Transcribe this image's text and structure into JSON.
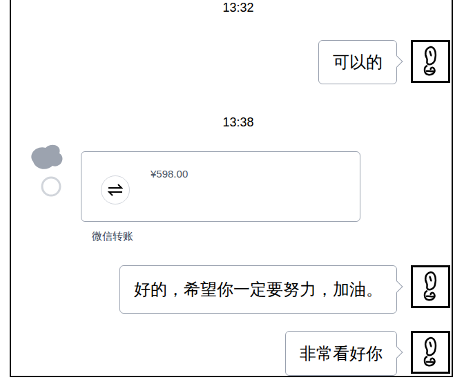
{
  "messages": [
    {
      "kind": "time",
      "text": "13:32"
    },
    {
      "kind": "sent",
      "text": "可以的"
    },
    {
      "kind": "time",
      "text": "13:38"
    },
    {
      "kind": "transfer",
      "amount": "¥598.00",
      "label": "微信转账"
    },
    {
      "kind": "sent",
      "text": "好的，希望你一定要努力，加油。"
    },
    {
      "kind": "sent",
      "text": "非常看好你"
    }
  ]
}
